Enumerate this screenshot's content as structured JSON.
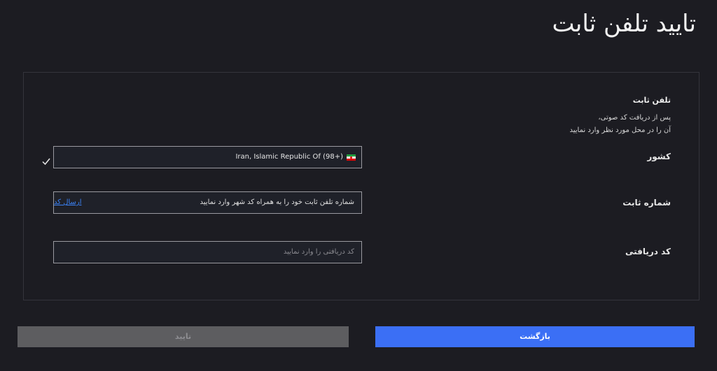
{
  "page": {
    "title": "تایید تلفن ثابت"
  },
  "section": {
    "title": "تلفن ثابت",
    "desc_line1": "پس از دریافت کد صوتی،",
    "desc_line2": "آن را در محل مورد نظر وارد نمایید"
  },
  "fields": {
    "country": {
      "label": "کشور",
      "value": "Iran, Islamic Republic Of (98+)",
      "flag": "iran-flag-icon",
      "status_icon": "check-icon"
    },
    "phone": {
      "label": "شماره ثابت",
      "value": "شماره تلفن ثابت خود را به همراه کد شهر وارد نمایید",
      "send_code_label": "ارسال کد"
    },
    "code": {
      "label": "کد دریافتی",
      "placeholder": "کد دریافتی را وارد نمایید"
    }
  },
  "buttons": {
    "confirm_label": "تایید",
    "back_label": "بازگشت"
  },
  "colors": {
    "background": "#1c1c22",
    "accent": "#3b6ff5",
    "disabled_button": "#5d5d60",
    "link": "#3b82f6"
  }
}
